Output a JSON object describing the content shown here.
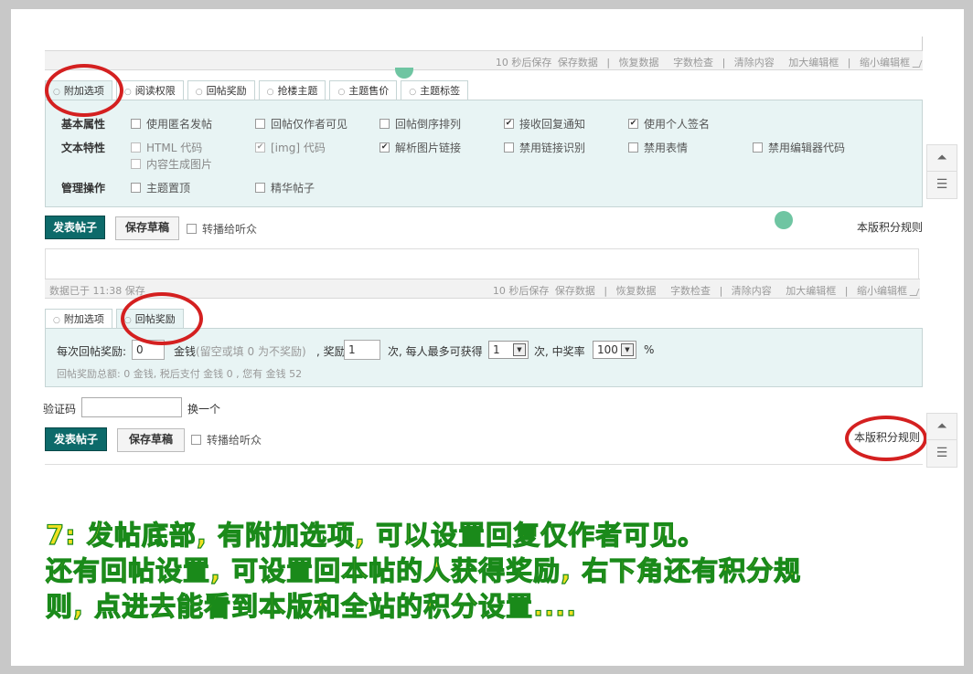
{
  "editor1": {
    "toolbar": {
      "autosave": "10 秒后保存",
      "save_data": "保存数据",
      "restore_data": "恢复数据",
      "word_count": "字数检查",
      "clear_content": "清除内容",
      "enlarge": "加大编辑框",
      "shrink": "缩小编辑框",
      "sep": "|"
    },
    "tabs": [
      "附加选项",
      "阅读权限",
      "回帖奖励",
      "抢楼主题",
      "主题售价",
      "主题标签"
    ],
    "rows": {
      "basic_label": "基本属性",
      "basic_opts": [
        {
          "label": "使用匿名发帖",
          "checked": false
        },
        {
          "label": "回帖仅作者可见",
          "checked": false
        },
        {
          "label": "回帖倒序排列",
          "checked": false
        },
        {
          "label": "接收回复通知",
          "checked": true
        },
        {
          "label": "使用个人签名",
          "checked": true
        }
      ],
      "text_label": "文本特性",
      "text_opts": [
        {
          "label": "HTML 代码",
          "checked": false
        },
        {
          "label": "[img] 代码",
          "checked": true
        },
        {
          "label": "解析图片链接",
          "checked": true
        },
        {
          "label": "禁用链接识别",
          "checked": false
        },
        {
          "label": "禁用表情",
          "checked": false
        },
        {
          "label": "禁用编辑器代码",
          "checked": false
        }
      ],
      "text_opt_extra": "内容生成图片",
      "manage_label": "管理操作",
      "manage_opts": [
        {
          "label": "主题置顶",
          "checked": false
        },
        {
          "label": "精华帖子",
          "checked": false
        }
      ]
    },
    "submit": "发表帖子",
    "save_draft": "保存草稿",
    "broadcast": "转播给听众",
    "credit_rules": "本版积分规则"
  },
  "editor2": {
    "status": "数据已于 11:38 保存",
    "toolbar": {
      "autosave": "10 秒后保存",
      "save_data": "保存数据",
      "restore_data": "恢复数据",
      "word_count": "字数检查",
      "clear_content": "清除内容",
      "enlarge": "加大编辑框",
      "shrink": "缩小编辑框",
      "sep": "|"
    },
    "tabs": [
      "附加选项",
      "回帖奖励"
    ],
    "reward": {
      "per_reply_label": "每次回帖奖励:",
      "per_reply_value": "0",
      "currency": "金钱",
      "hint": "(留空或填 0 为不奖励)",
      "times_label": ", 奖励",
      "times_value": "1",
      "max_label": "次, 每人最多可获得",
      "max_value": "1",
      "chance_label": "次, 中奖率",
      "chance_value": "100",
      "percent": "%",
      "summary": "回帖奖励总额: 0 金钱, 税后支付 金钱 0 , 您有 金钱 52"
    },
    "captcha_label": "验证码",
    "captcha_change": "换一个",
    "submit": "发表帖子",
    "save_draft": "保存草稿",
    "broadcast": "转播给听众",
    "credit_rules": "本版积分规则"
  },
  "caption": {
    "line1": "7: 发帖底部, 有附加选项, 可以设置回复仅作者可见。",
    "line2": "还有回帖设置, 可设置回本帖的人获得奖励, 右下角还有积分规",
    "line3": "则, 点进去能看到本版和全站的积分设置...."
  },
  "colors": {
    "accent": "#0d6a6a",
    "panel_bg": "#e8f4f4",
    "highlight_ring": "#d42020",
    "caption_fill": "#f0e020",
    "caption_stroke": "#1a8a1a"
  },
  "icons": {
    "back_to_top": "back-to-top-icon",
    "list": "list-icon"
  }
}
